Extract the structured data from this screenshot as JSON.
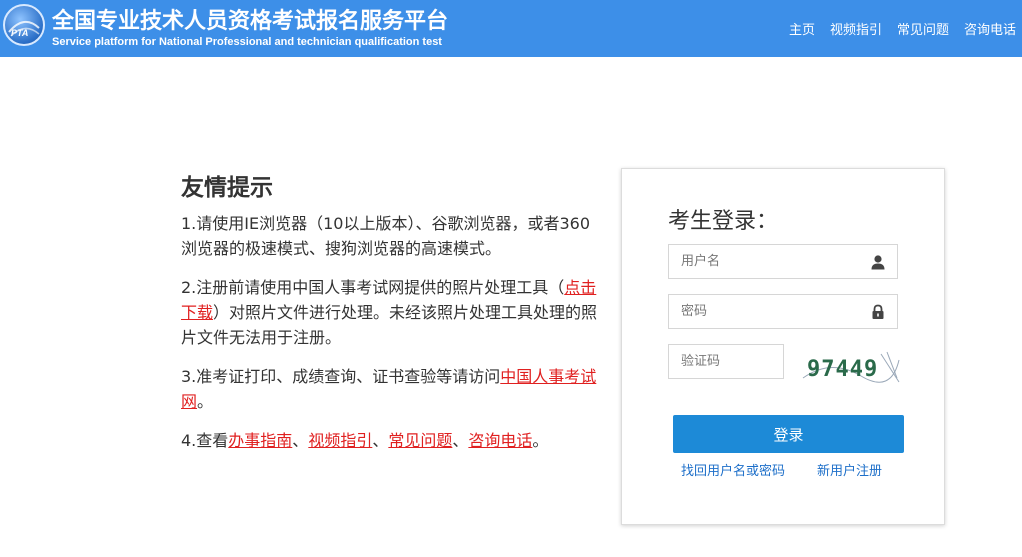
{
  "header": {
    "logo_text": "PTA",
    "title": "全国专业技术人员资格考试报名服务平台",
    "subtitle": "Service platform for National Professional and technician qualification test",
    "nav": [
      "主页",
      "视频指引",
      "常见问题",
      "咨询电话"
    ]
  },
  "tips": {
    "title": "友情提示",
    "tip1": "1.请使用IE浏览器（10以上版本）、谷歌浏览器，或者360浏览器的极速模式、搜狗浏览器的高速模式。",
    "tip2_a": "2.注册前请使用中国人事考试网提供的照片处理工具（",
    "tip2_link": "点击下载",
    "tip2_b": "）对照片文件进行处理。未经该照片处理工具处理的照片文件无法用于注册。",
    "tip3_a": "3.准考证打印、成绩查询、证书查验等请访问",
    "tip3_link": "中国人事考试网",
    "tip3_b": "。",
    "tip4_a": "4.查看",
    "tip4_links": [
      "办事指南",
      "视频指引",
      "常见问题",
      "咨询电话"
    ],
    "tip4_sep": "、",
    "tip4_end": "。"
  },
  "login": {
    "title": "考生登录：",
    "username_placeholder": "用户名",
    "password_placeholder": "密码",
    "captcha_placeholder": "验证码",
    "captcha_text": "97449",
    "submit_label": "登录",
    "forgot_label": "找回用户名或密码",
    "register_label": "新用户注册"
  },
  "colors": {
    "header_bg": "#3d8fe8",
    "accent": "#1d8ad7",
    "link_red": "#e02020",
    "link_blue": "#1d6fc9"
  },
  "icons": {
    "username": "user-icon",
    "password": "lock-icon"
  }
}
